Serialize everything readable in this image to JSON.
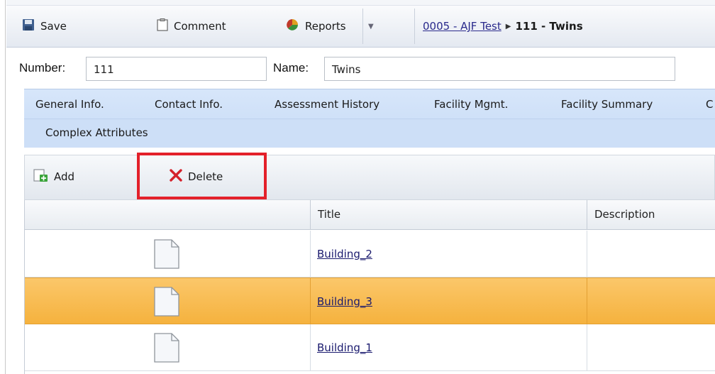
{
  "toolbar": {
    "save_label": "Save",
    "comment_label": "Comment",
    "reports_label": "Reports",
    "breadcrumb_parent": "0005 - AJF Test",
    "breadcrumb_current": "111 - Twins"
  },
  "record": {
    "number_label": "Number:",
    "number_value": "111",
    "name_label": "Name:",
    "name_value": "Twins"
  },
  "tabs": {
    "row1": [
      "General Info.",
      "Contact Info.",
      "Assessment History",
      "Facility Mgmt.",
      "Facility Summary",
      "C"
    ],
    "row2": [
      "Complex Attributes"
    ]
  },
  "grid_toolbar": {
    "add_label": "Add",
    "delete_label": "Delete"
  },
  "grid": {
    "columns": [
      "",
      "Title",
      "Description"
    ],
    "rows": [
      {
        "title": "Building_2",
        "description": "",
        "selected": false
      },
      {
        "title": "Building_3",
        "description": "",
        "selected": true
      },
      {
        "title": "Building_1",
        "description": "",
        "selected": false
      }
    ]
  },
  "colors": {
    "highlight": "#e3202a",
    "selected_row": "#f5b23e",
    "tab_bar": "#c7dbf6",
    "link": "#2a2a8c"
  },
  "icons": [
    "save-icon",
    "comment-icon",
    "reports-icon",
    "dropdown-arrow-icon",
    "breadcrumb-arrow-icon",
    "add-icon",
    "delete-icon",
    "document-icon"
  ]
}
